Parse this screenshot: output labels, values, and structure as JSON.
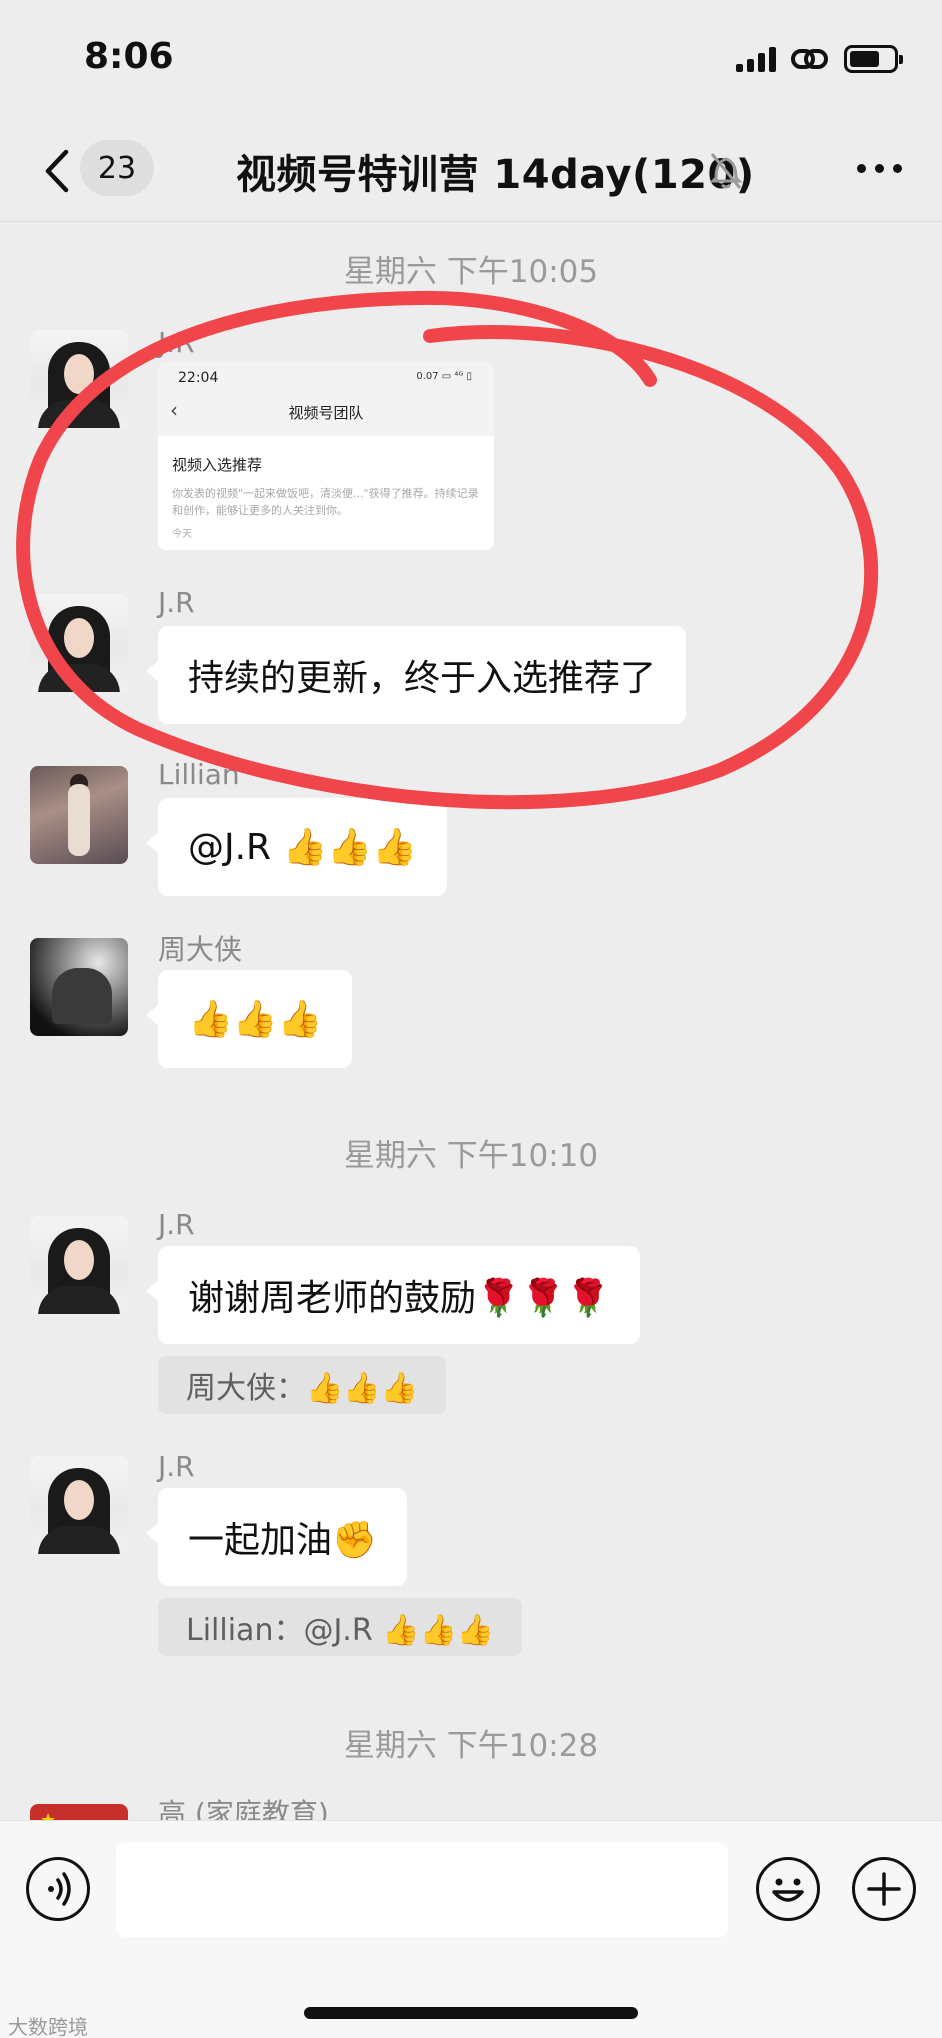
{
  "status_bar": {
    "time": "8:06"
  },
  "nav": {
    "unread_count": "23",
    "title": "视频号特训营 14day(120)"
  },
  "messages_section": {
    "timestamps": [
      "星期六 下午10:05",
      "星期六 下午10:10",
      "星期六 下午10:28"
    ],
    "senders": {
      "jr": "J.R",
      "lillian": "Lillian",
      "zhou": "周大侠",
      "gao": "高 (家庭教育)"
    },
    "screenshot": {
      "time": "22:04",
      "status_icons": "0.07 ▭ ⁴ᴳ ▯",
      "title": "视频号团队",
      "card_title": "视频入选推荐",
      "card_body": "你发表的视频\"一起来做饭吧，清淡便...\"获得了推荐。持续记录和创作，能够让更多的人关注到你。",
      "card_time": "今天"
    },
    "msg_jr_1": "持续的更新，终于入选推荐了",
    "msg_lillian": "@J.R 👍👍👍",
    "msg_zhou": "👍👍👍",
    "msg_jr_2": "谢谢周老师的鼓励🌹🌹🌹",
    "quote_1": "周大侠：👍👍👍",
    "msg_jr_3": "一起加油✊",
    "quote_2": "Lillian：@J.R 👍👍👍"
  },
  "watermark": "大数跨境",
  "colors": {
    "annotation": "#f0454a",
    "background": "#ededed",
    "bubble": "#ffffff"
  }
}
